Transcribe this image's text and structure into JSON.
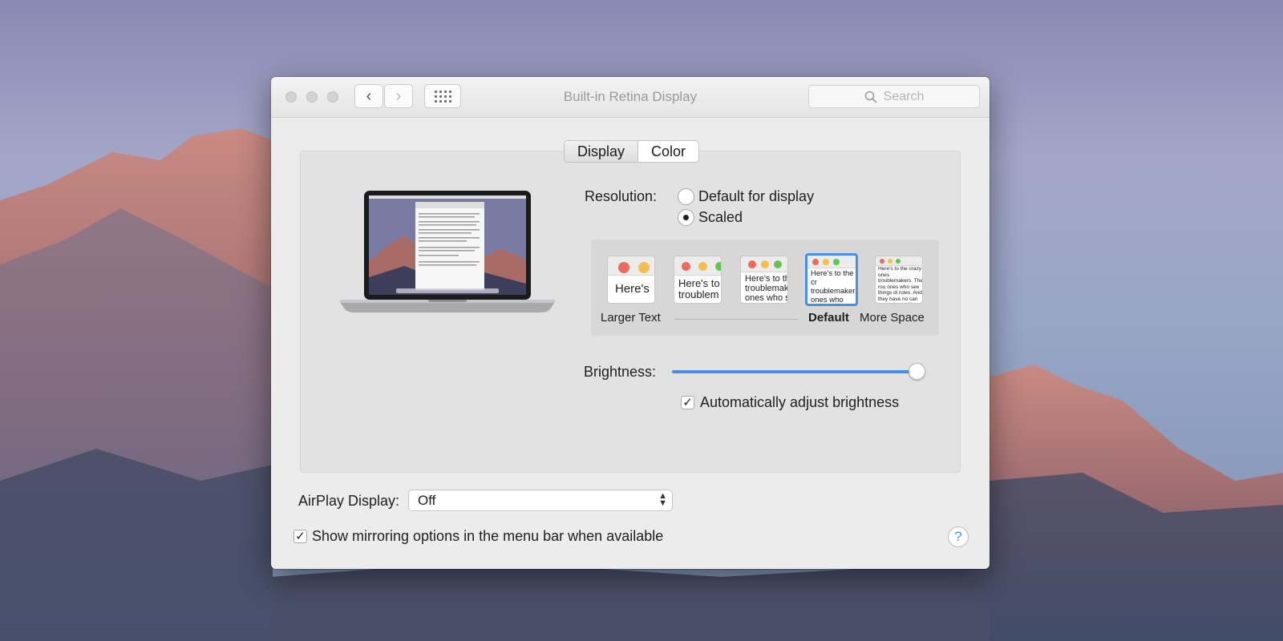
{
  "window": {
    "title": "Built-in Retina Display",
    "search_placeholder": "Search",
    "back_icon": "‹",
    "forward_icon": "›"
  },
  "tabs": [
    {
      "label": "Display",
      "selected": true
    },
    {
      "label": "Color",
      "selected": false
    }
  ],
  "resolution": {
    "label": "Resolution:",
    "options": [
      {
        "label": "Default for display",
        "selected": false
      },
      {
        "label": "Scaled",
        "selected": true
      }
    ]
  },
  "scaling": {
    "thumb_texts": [
      "Here's",
      "Here's to troublem",
      "Here's to th troublemak ones who s",
      "Here's to the cr troublemakers. ones who see t rules. And they",
      "Here's to the crazy ones troublemakers. The rou ones who see things di rules. And they have no can quote them, disgra them. About the only th Because they change t"
    ],
    "labels": [
      "Larger Text",
      "Default",
      "More Space"
    ],
    "selected_index": 3
  },
  "brightness": {
    "label": "Brightness:",
    "level": 1.0,
    "auto_label": "Automatically adjust brightness",
    "auto_checked": true
  },
  "airplay": {
    "label": "AirPlay Display:",
    "value": "Off"
  },
  "mirroring": {
    "label": "Show mirroring options in the menu bar when available",
    "checked": true
  },
  "help_icon": "?",
  "check_mark": "✓",
  "colors": {
    "accent": "#4a90e2",
    "traffic_red": "#ed6a5e",
    "traffic_yellow": "#f5bf4f",
    "traffic_green": "#61c554"
  }
}
